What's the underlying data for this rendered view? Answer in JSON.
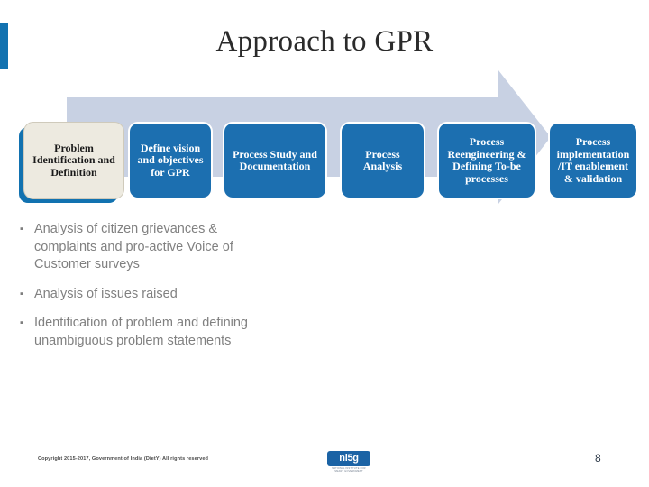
{
  "slide": {
    "title": "Approach to GPR",
    "accent_color": "#1272B0",
    "arrow_color": "#C8D1E3",
    "step_blue": "#1C6FB0",
    "step_cream": "#EDEAE0"
  },
  "process": {
    "steps": [
      {
        "label": "Problem Identification and Definition",
        "style": "cream"
      },
      {
        "label": "Define vision and objectives for GPR",
        "style": "blue"
      },
      {
        "label": "Process Study and Documentation",
        "style": "blue"
      },
      {
        "label": "Process Analysis",
        "style": "blue"
      },
      {
        "label": "Process Reengineering & Defining To-be processes",
        "style": "blue"
      },
      {
        "label": "Process implementation  /IT enablement & validation",
        "style": "blue"
      }
    ]
  },
  "bullets": [
    {
      "marker": "▪",
      "text": "Analysis of citizen grievances & complaints and pro-active Voice of Customer surveys"
    },
    {
      "marker": "▪",
      "text": "Analysis of issues raised"
    },
    {
      "marker": "▪",
      "text": "Identification of problem and defining unambiguous problem statements"
    }
  ],
  "footer": {
    "copyright": "Copyright 2015-2017, Government of India (DietY) All rights reserved",
    "logo_text": "ni5g",
    "logo_subtext": "NATIONAL INSTITUTE FOR SMART GOVERNMENT",
    "page_number": "8"
  }
}
